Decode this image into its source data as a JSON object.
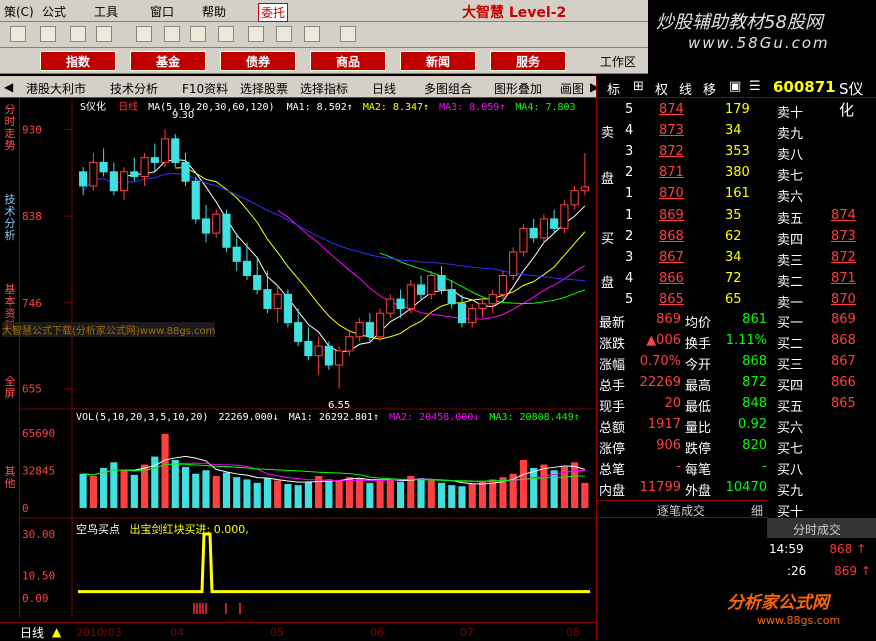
{
  "menu": [
    "策(C)",
    "公式",
    "工具",
    "窗口",
    "帮助",
    "委托"
  ],
  "app_brand": "大智慧 Level-2",
  "logo": {
    "line1": "炒股辅助教材58股网",
    "line2": "www.58Gu.com"
  },
  "big_buttons": [
    "指数",
    "基金",
    "债券",
    "商品",
    "新闻",
    "服务"
  ],
  "workzone_label": "工作区",
  "tabs": [
    "港股大利市",
    "技术分析",
    "F10资料",
    "选择股票",
    "选择指标",
    "日线",
    "多图组合",
    "图形叠加",
    "画图"
  ],
  "side_tabs": [
    "分时走势",
    "技术分析",
    "基本资料",
    "全屏",
    "其他"
  ],
  "chart": {
    "name": "S仪化",
    "period": "日线",
    "ma_legend": "MA(5,10,20,30,60,120)",
    "ma1": "MA1: 8.502↑",
    "ma2": "MA2: 8.347↑",
    "ma3": "MA3: 8.059↑",
    "ma4": "MA4: 7.803",
    "price_ticks": [
      "930",
      "838",
      "746",
      "655"
    ],
    "high_mark": "9.30",
    "low_mark": "6.55",
    "vol_legend": "VOL(5,10,20,3,5,10,20)",
    "vol_val": "22269.000↓",
    "vol_ma1": "MA1: 26292.801↑",
    "vol_ma2": "MA2: 20458.000↓",
    "vol_ma3": "MA3: 20808.449↑",
    "vol_ticks": [
      "65690",
      "32845",
      "0"
    ],
    "ind_legend": "空鸟买点",
    "ind_legend2": "出宝剑红块买进: 0.000,",
    "ind_ticks": [
      "30.00",
      "10.50",
      "0.00"
    ],
    "watermark": "大智慧公式下载(分析家公式网)www.88gs.com",
    "date_labels": [
      "2010/03",
      "04",
      "05",
      "06",
      "07",
      "08"
    ],
    "bottom_label": "日线"
  },
  "quote": {
    "tabs": [
      "标",
      "权",
      "线",
      "移"
    ],
    "code": "600871",
    "name": "S仪化",
    "sell": [
      [
        "5",
        "874",
        "179",
        "卖十"
      ],
      [
        "4",
        "873",
        "34",
        "卖九"
      ],
      [
        "3",
        "872",
        "353",
        "卖八"
      ],
      [
        "2",
        "871",
        "380",
        "卖七"
      ],
      [
        "1",
        "870",
        "161",
        "卖六"
      ]
    ],
    "sell_label": [
      "卖",
      "盘"
    ],
    "buy": [
      [
        "1",
        "869",
        "35",
        "卖五",
        "874"
      ],
      [
        "2",
        "868",
        "62",
        "卖四",
        "873"
      ],
      [
        "3",
        "867",
        "34",
        "卖三",
        "872"
      ],
      [
        "4",
        "866",
        "72",
        "卖二",
        "871"
      ],
      [
        "5",
        "865",
        "65",
        "卖一",
        "870"
      ]
    ],
    "buy_label": [
      "买",
      "盘"
    ],
    "stats": [
      [
        "最新",
        "869",
        "均价",
        "861",
        "买一",
        "869"
      ],
      [
        "涨跌",
        "▲006",
        "换手",
        "1.11%",
        "买二",
        "868"
      ],
      [
        "涨幅",
        "0.70%",
        "今开",
        "868",
        "买三",
        "867"
      ],
      [
        "总手",
        "22269",
        "最高",
        "872",
        "买四",
        "866"
      ],
      [
        "现手",
        "20",
        "最低",
        "848",
        "买五",
        "865"
      ],
      [
        "总额",
        "1917",
        "量比",
        "0.92",
        "买六",
        ""
      ],
      [
        "涨停",
        "906",
        "跌停",
        "820",
        "买七",
        ""
      ],
      [
        "总笔",
        "-",
        "每笔",
        "-",
        "买八",
        ""
      ],
      [
        "内盘",
        "11799",
        "外盘",
        "10470",
        "买九",
        ""
      ],
      [
        "",
        "",
        "",
        "",
        "买十",
        ""
      ]
    ],
    "trade_title": "逐笔成交",
    "detail": "细",
    "min_title": "分时成交",
    "trades": [
      [
        "14:59",
        "868"
      ],
      [
        ":26",
        "869"
      ]
    ],
    "footer_brand": "分析家公式网",
    "footer_url": "www.88gs.com"
  },
  "chart_data": {
    "type": "candlestick",
    "price_range": [
      6.55,
      9.3
    ],
    "candles": [
      [
        8.85,
        8.9,
        8.6,
        8.7
      ],
      [
        8.7,
        9.05,
        8.65,
        8.95
      ],
      [
        8.95,
        9.1,
        8.8,
        8.85
      ],
      [
        8.85,
        8.95,
        8.6,
        8.65
      ],
      [
        8.65,
        8.9,
        8.55,
        8.85
      ],
      [
        8.85,
        9.0,
        8.75,
        8.8
      ],
      [
        8.8,
        9.05,
        8.7,
        9.0
      ],
      [
        9.0,
        9.15,
        8.85,
        8.95
      ],
      [
        8.95,
        9.3,
        8.9,
        9.2
      ],
      [
        9.2,
        9.25,
        8.9,
        8.95
      ],
      [
        8.95,
        9.05,
        8.7,
        8.75
      ],
      [
        8.75,
        8.8,
        8.3,
        8.35
      ],
      [
        8.35,
        8.5,
        8.1,
        8.2
      ],
      [
        8.2,
        8.45,
        8.15,
        8.4
      ],
      [
        8.4,
        8.45,
        8.0,
        8.05
      ],
      [
        8.05,
        8.2,
        7.8,
        7.9
      ],
      [
        7.9,
        8.1,
        7.7,
        7.75
      ],
      [
        7.75,
        7.95,
        7.55,
        7.6
      ],
      [
        7.6,
        7.8,
        7.35,
        7.4
      ],
      [
        7.4,
        7.65,
        7.25,
        7.55
      ],
      [
        7.55,
        7.6,
        7.2,
        7.25
      ],
      [
        7.25,
        7.4,
        7.0,
        7.05
      ],
      [
        7.05,
        7.2,
        6.85,
        6.9
      ],
      [
        6.9,
        7.1,
        6.7,
        7.0
      ],
      [
        7.0,
        7.05,
        6.75,
        6.8
      ],
      [
        6.8,
        7.0,
        6.55,
        6.95
      ],
      [
        6.95,
        7.15,
        6.9,
        7.1
      ],
      [
        7.1,
        7.3,
        7.05,
        7.25
      ],
      [
        7.25,
        7.35,
        7.05,
        7.1
      ],
      [
        7.1,
        7.4,
        7.05,
        7.35
      ],
      [
        7.35,
        7.55,
        7.3,
        7.5
      ],
      [
        7.5,
        7.6,
        7.3,
        7.4
      ],
      [
        7.4,
        7.7,
        7.35,
        7.65
      ],
      [
        7.65,
        7.75,
        7.5,
        7.55
      ],
      [
        7.55,
        7.8,
        7.5,
        7.75
      ],
      [
        7.75,
        7.85,
        7.55,
        7.6
      ],
      [
        7.6,
        7.7,
        7.4,
        7.45
      ],
      [
        7.45,
        7.55,
        7.2,
        7.25
      ],
      [
        7.25,
        7.45,
        7.2,
        7.4
      ],
      [
        7.4,
        7.5,
        7.3,
        7.45
      ],
      [
        7.45,
        7.6,
        7.35,
        7.55
      ],
      [
        7.55,
        7.8,
        7.5,
        7.75
      ],
      [
        7.75,
        8.05,
        7.7,
        8.0
      ],
      [
        8.0,
        8.3,
        7.95,
        8.25
      ],
      [
        8.25,
        8.35,
        8.1,
        8.15
      ],
      [
        8.15,
        8.4,
        8.1,
        8.35
      ],
      [
        8.35,
        8.45,
        8.2,
        8.25
      ],
      [
        8.25,
        8.55,
        8.2,
        8.5
      ],
      [
        8.5,
        8.7,
        8.45,
        8.65
      ],
      [
        8.65,
        9.05,
        8.6,
        8.69
      ]
    ],
    "volume": [
      30,
      28,
      35,
      40,
      33,
      29,
      38,
      45,
      65,
      42,
      36,
      30,
      33,
      28,
      31,
      27,
      25,
      22,
      26,
      24,
      21,
      20,
      23,
      28,
      25,
      24,
      27,
      26,
      22,
      24,
      25,
      23,
      28,
      26,
      24,
      22,
      20,
      19,
      21,
      23,
      25,
      27,
      30,
      42,
      35,
      38,
      33,
      36,
      40,
      22
    ],
    "indicator": {
      "spike_index": 12,
      "spike_value": 30.0,
      "base": 3.0
    }
  }
}
